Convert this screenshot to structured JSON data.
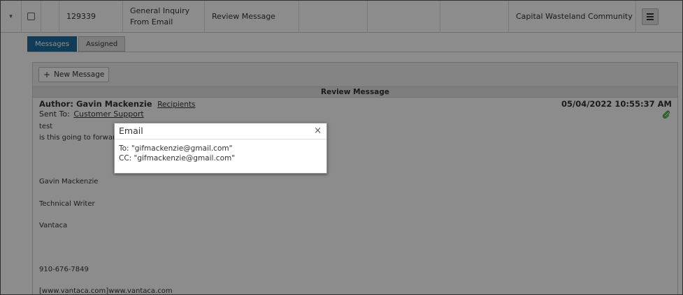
{
  "row": {
    "caret": "▾",
    "id": "129339",
    "type_line1": "General Inquiry",
    "type_line2": "From Email",
    "status": "Review Message",
    "community": "Capital Wasteland Community"
  },
  "tabs": {
    "messages": "Messages",
    "assigned": "Assigned"
  },
  "panel": {
    "new_message": "New Message",
    "new_message_icon": "+",
    "section_title": "Review Message",
    "author_label": "Author: Gavin Mackenzie",
    "recipients_link": "Recipients",
    "date": "05/04/2022 10:55:37 AM",
    "sent_to_label": "Sent To:",
    "sent_to_value": "Customer Support",
    "body": {
      "l1": "test",
      "l2": "is this going to forward",
      "name": "Gavin Mackenzie",
      "title": "Technical Writer",
      "company": "Vantaca",
      "phone": "910-676-7849",
      "website": "[www.vantaca.com]www.vantaca.com"
    }
  },
  "modal": {
    "title": "Email",
    "close": "×",
    "to_line": "To: \"gifmackenzie@gmail.com\"",
    "cc_line": "CC: \"gifmackenzie@gmail.com\""
  },
  "colors": {
    "tab_active": "#1f6e9e",
    "attachment": "#3aa53a"
  }
}
